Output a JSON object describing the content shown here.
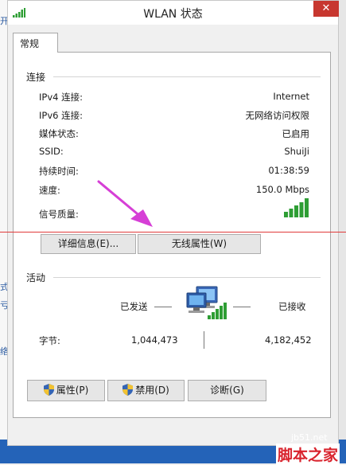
{
  "window": {
    "title": "WLAN 状态",
    "close_label": "✕"
  },
  "tabs": [
    {
      "label": "常规"
    }
  ],
  "connection": {
    "section_title": "连接",
    "rows": [
      {
        "label": "IPv4 连接:",
        "value": "Internet"
      },
      {
        "label": "IPv6 连接:",
        "value": "无网络访问权限"
      },
      {
        "label": "媒体状态:",
        "value": "已启用"
      },
      {
        "label": "SSID:",
        "value": "ShuiJi"
      },
      {
        "label": "持续时间:",
        "value": "01:38:59"
      },
      {
        "label": "速度:",
        "value": "150.0 Mbps"
      },
      {
        "label": "信号质量:",
        "value": ""
      }
    ],
    "details_button": "详细信息(E)...",
    "wireless_props_button": "无线属性(W)"
  },
  "activity": {
    "section_title": "活动",
    "sent_label": "已发送",
    "received_label": "已接收",
    "bytes_label": "字节:",
    "bytes_sent": "1,044,473",
    "bytes_received": "4,182,452"
  },
  "buttons": {
    "properties": "属性(P)",
    "disable": "禁用(D)",
    "diagnose": "诊断(G)"
  },
  "background": {
    "left_glyphs": [
      "开",
      "式",
      "亏",
      "络"
    ]
  },
  "watermark": {
    "site": "jb51.net",
    "brand": "脚本之家"
  },
  "colors": {
    "signal_green": "#2e9e34",
    "close_red": "#c7372f",
    "annotation_arrow": "#d63fd6",
    "watermark_red": "#d9232d"
  }
}
